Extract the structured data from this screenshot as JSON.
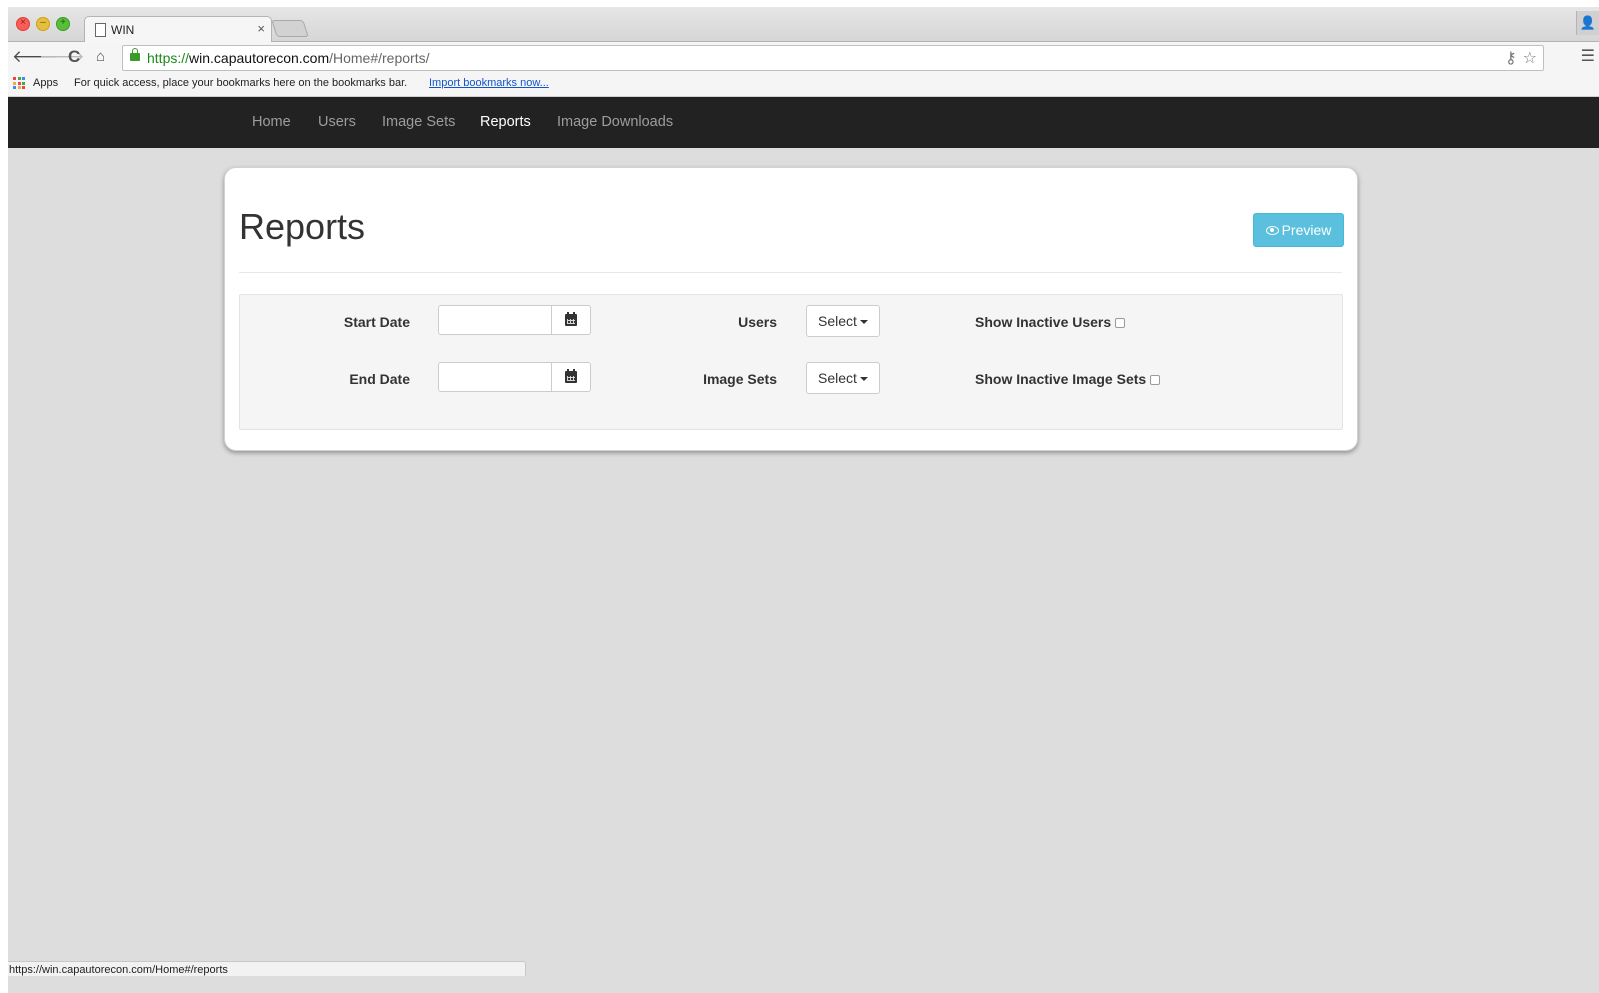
{
  "browser": {
    "tab_title": "WIN",
    "tab_close": "×",
    "url_scheme": "https://",
    "url_host": "win.capautorecon.com",
    "url_path": "/Home#/reports/",
    "bookmarks_apps": "Apps",
    "bookmarks_hint": "For quick access, place your bookmarks here on the bookmarks bar.",
    "bookmarks_link": "Import bookmarks now...",
    "status_url": "https://win.capautorecon.com/Home#/reports"
  },
  "nav": {
    "items": [
      {
        "label": "Home",
        "active": false
      },
      {
        "label": "Users",
        "active": false
      },
      {
        "label": "Image Sets",
        "active": false
      },
      {
        "label": "Reports",
        "active": true
      },
      {
        "label": "Image Downloads",
        "active": false
      }
    ]
  },
  "page": {
    "title": "Reports",
    "preview_label": "Preview"
  },
  "filters": {
    "start_date_label": "Start Date",
    "start_date_value": "",
    "end_date_label": "End Date",
    "end_date_value": "",
    "users_label": "Users",
    "users_select": "Select",
    "image_sets_label": "Image Sets",
    "image_sets_select": "Select",
    "show_inactive_users_label": "Show Inactive Users",
    "show_inactive_users_checked": false,
    "show_inactive_image_sets_label": "Show Inactive Image Sets",
    "show_inactive_image_sets_checked": false
  },
  "colors": {
    "navbar_bg": "#222222",
    "nav_text": "#9d9d9d",
    "nav_active": "#ffffff",
    "preview_button": "#5bc0de",
    "page_bg": "#dddddd"
  }
}
